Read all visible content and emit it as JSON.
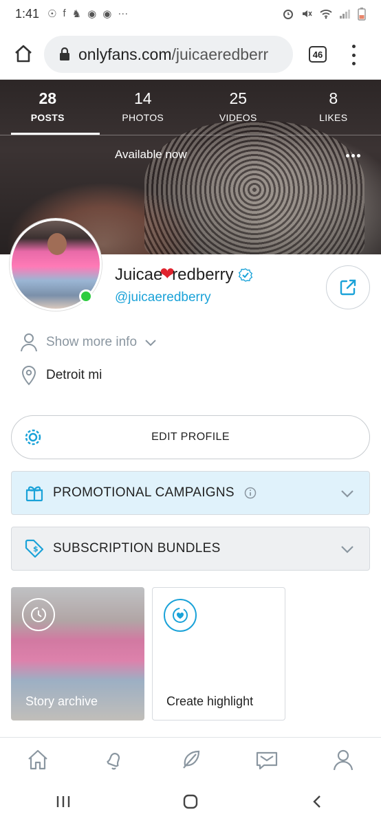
{
  "status_bar": {
    "time": "1:41",
    "notification_icons": [
      "☉",
      "f",
      "♞",
      "◉",
      "◉",
      "···"
    ],
    "system_icons": [
      "⏰",
      "🔇",
      "wifi",
      "signal",
      "battery"
    ]
  },
  "browser": {
    "url_domain": "onlyfans.com",
    "url_path": "/juicaeredberr",
    "tab_count": "46"
  },
  "stats": [
    {
      "value": "28",
      "label": "POSTS",
      "active": true
    },
    {
      "value": "14",
      "label": "PHOTOS",
      "active": false
    },
    {
      "value": "25",
      "label": "VIDEOS",
      "active": false
    },
    {
      "value": "8",
      "label": "LIKES",
      "active": false
    }
  ],
  "profile": {
    "status": "Available now",
    "name_part1": "Juicae",
    "name_heart": "❤",
    "name_part2": "redberry",
    "handle": "@juicaeredberry",
    "show_more_label": "Show more info",
    "location": "Detroit mi"
  },
  "buttons": {
    "edit_profile": "EDIT PROFILE"
  },
  "sections": {
    "promotional": "PROMOTIONAL CAMPAIGNS",
    "subscription": "SUBSCRIPTION BUNDLES"
  },
  "highlights": {
    "story_archive": "Story archive",
    "create_highlight": "Create highlight"
  },
  "colors": {
    "accent": "#1aa2d8",
    "online": "#2ecc40",
    "promo_bg": "#e0f2fb"
  }
}
